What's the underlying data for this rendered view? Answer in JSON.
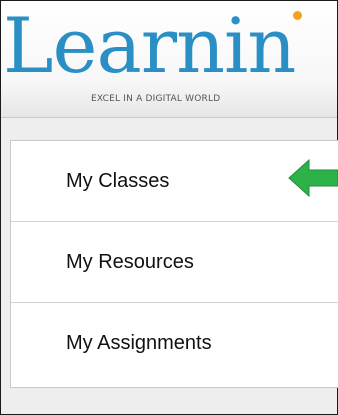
{
  "header": {
    "logo_text": "Learnin",
    "tagline": "EXCEL IN A DIGITAL WORLD"
  },
  "menu": {
    "items": [
      {
        "label": "My Classes",
        "highlighted": true
      },
      {
        "label": "My Resources",
        "highlighted": false
      },
      {
        "label": "My Assignments",
        "highlighted": false
      }
    ]
  },
  "colors": {
    "logo": "#2a8fc4",
    "logo_dot": "#f5a21a",
    "arrow": "#2db24a"
  },
  "icons": {
    "highlight": "arrow-left-icon"
  }
}
